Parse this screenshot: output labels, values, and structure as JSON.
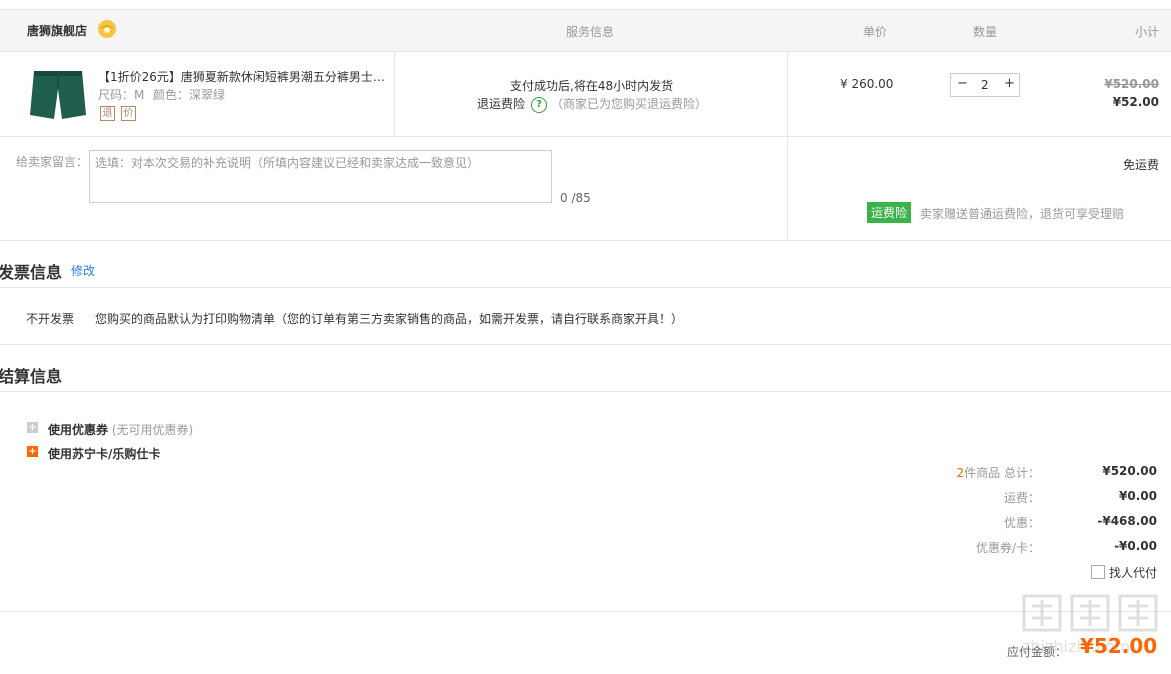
{
  "table_header": {
    "store_name": "唐狮旗舰店",
    "service": "服务信息",
    "unit_price": "单价",
    "quantity": "数量",
    "subtotal": "小计"
  },
  "product": {
    "title": "【1折价26元】唐狮夏新款休闲短裤男潮五分裤男士…",
    "size": "尺码：M",
    "color": "颜色：深翠绿",
    "tag_return": "退",
    "tag_price": "价",
    "image_color": "#1f5e4f"
  },
  "service": {
    "shipping_note": "支付成功后,将在48小时内发货",
    "insurance_label": "退运费险",
    "insurance_desc": "（商家已为您购买退运费险）"
  },
  "price": {
    "unit": "¥ 260.00",
    "qty_minus": "−",
    "qty_value": "2",
    "qty_plus": "+",
    "original_subtotal": "¥520.00",
    "subtotal": "¥52.00"
  },
  "message": {
    "label": "给卖家留言：",
    "placeholder": "选填：对本次交易的补充说明（所填内容建议已经和卖家达成一致意见）",
    "counter": "0 /85"
  },
  "shipping": {
    "free_label": "免运费",
    "badge": "运费险",
    "badge_desc": "卖家赠送普通运费险，退货可享受理赔"
  },
  "invoice": {
    "title": "发票信息",
    "edit_link": "修改",
    "type": "不开发票",
    "desc": "您购买的商品默认为打印购物清单（您的订单有第三方卖家销售的商品，如需开发票，请自行联系商家开具！）"
  },
  "settlement": {
    "title": "结算信息",
    "coupon_label": "使用优惠券",
    "coupon_note": "(无可用优惠券)",
    "card_label": "使用苏宁卡/乐购仕卡"
  },
  "summary": {
    "item_count": "2",
    "items_label": "件商品 总计：",
    "items_total": "¥520.00",
    "freight_label": "运费：",
    "freight": "¥0.00",
    "discount_label": "优惠：",
    "discount": "-¥468.00",
    "coupon_card_label": "优惠券/卡：",
    "coupon_card": "-¥0.00",
    "pay_for_me": "找人代付",
    "payable_label": "应付金额：",
    "payable": "¥52.00"
  },
  "watermark": {
    "text": "zhizhizhi.com"
  },
  "colors": {
    "accent_orange": "#ff6600",
    "green": "#3cb24a",
    "link_blue": "#2a7ae2"
  }
}
